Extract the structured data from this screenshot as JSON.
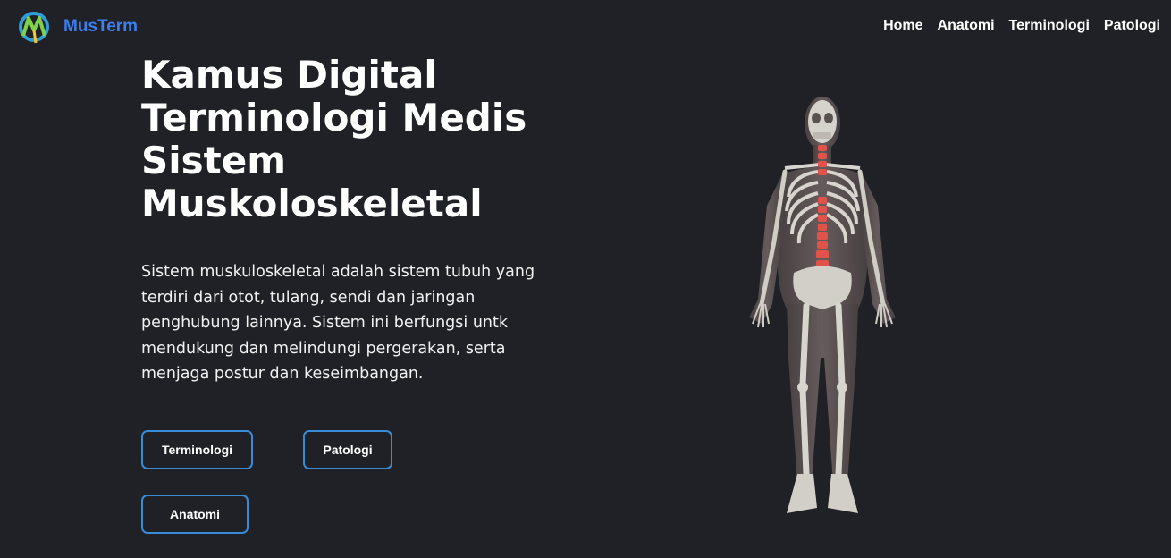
{
  "nav": {
    "brand": "MusTerm",
    "links": [
      "Home",
      "Anatomi",
      "Terminologi",
      "Patologi"
    ]
  },
  "hero": {
    "title_lines": [
      "Kamus Digital",
      "Terminologi Medis",
      "Sistem",
      "Muskoloskeletal"
    ],
    "description_lines": [
      "Sistem muskuloskeletal adalah sistem tubuh yang",
      "terdiri dari otot, tulang, sendi dan jaringan",
      "penghubung lainnya. Sistem ini berfungsi untk",
      "mendukung dan melindungi pergerakan, serta",
      "menjaga postur dan keseimbangan."
    ]
  },
  "buttons": {
    "terminologi": "Terminologi",
    "patologi": "Patologi",
    "anatomi": "Anatomi"
  },
  "colors": {
    "background": "#202126",
    "brand": "#3d7ff0",
    "button_border": "#3a8bd6",
    "spine_highlight": "#e0524a"
  },
  "icons": {
    "logo": "musterm-logo-icon",
    "illustration": "skeleton-illustration"
  }
}
